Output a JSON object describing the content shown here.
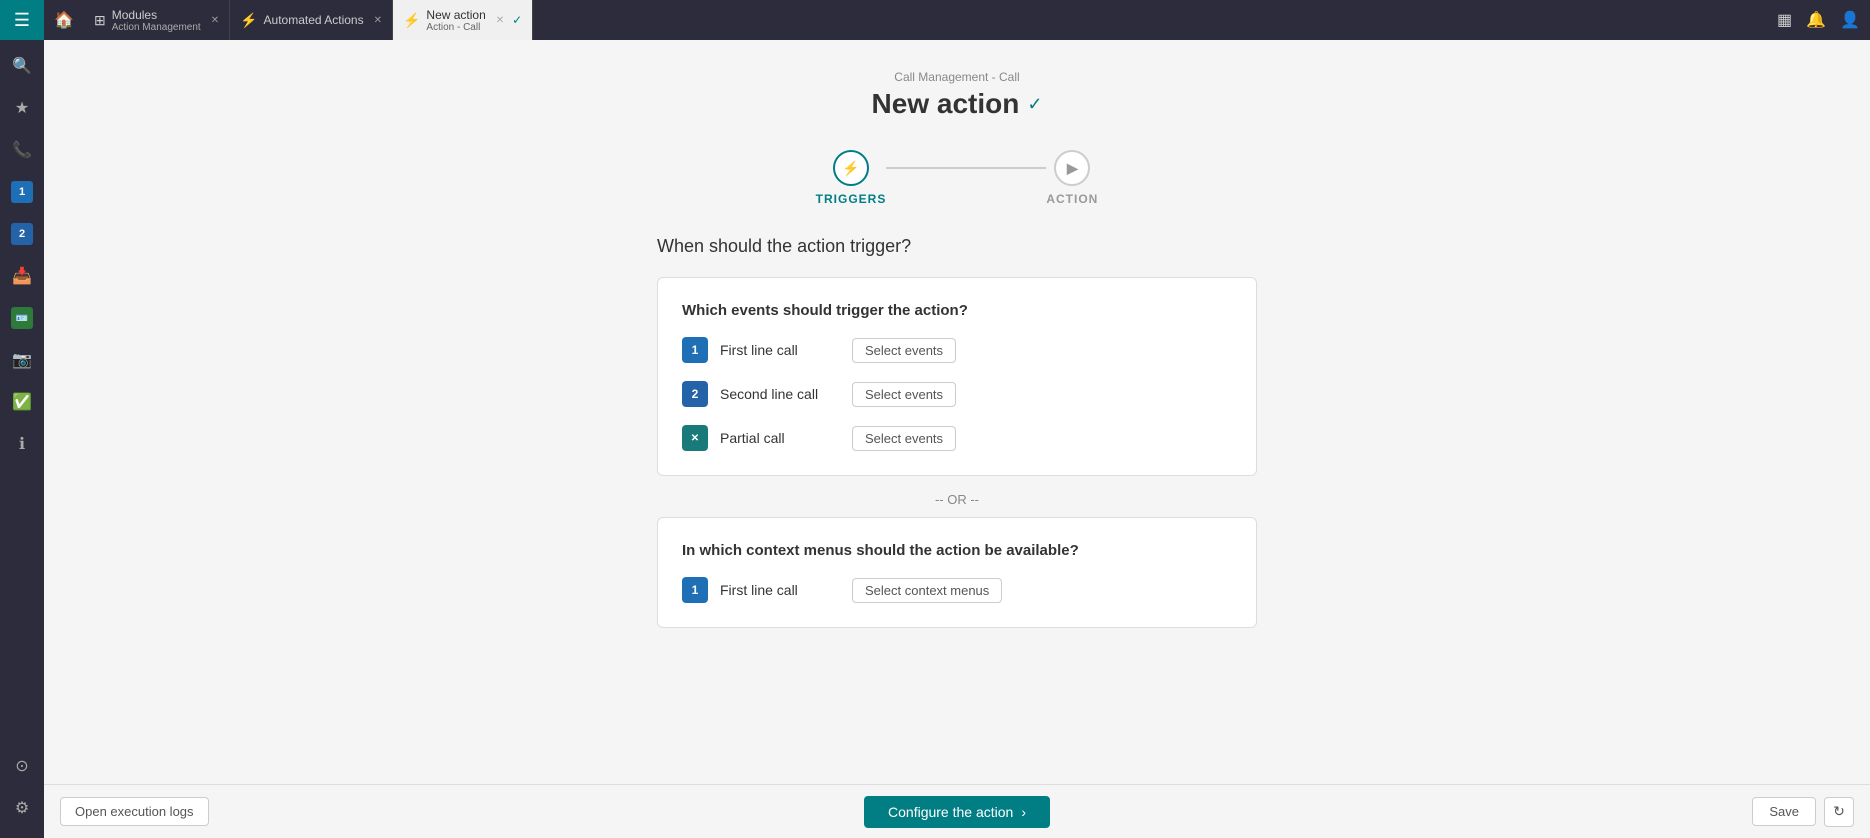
{
  "topbar": {
    "tabs": [
      {
        "id": "modules",
        "icon": "⊞",
        "label": "Modules",
        "sublabel": "Action Management",
        "active": false,
        "closable": true
      },
      {
        "id": "automated-actions",
        "icon": "⚡",
        "label": "Automated Actions",
        "sublabel": "",
        "active": false,
        "closable": true
      },
      {
        "id": "new-action",
        "icon": "⚡",
        "label": "New action",
        "sublabel": "Action - Call",
        "active": true,
        "closable": true
      }
    ],
    "right_icons": [
      "▦",
      "🔔",
      "👤"
    ]
  },
  "sidebar": {
    "items": [
      {
        "id": "search",
        "icon": "🔍"
      },
      {
        "id": "star",
        "icon": "★"
      },
      {
        "id": "phone",
        "icon": "📞"
      },
      {
        "id": "badge1",
        "icon": "①"
      },
      {
        "id": "badge2",
        "icon": "②"
      },
      {
        "id": "inbox",
        "icon": "📥"
      },
      {
        "id": "badge-green",
        "icon": "🪪"
      },
      {
        "id": "camera",
        "icon": "📷"
      },
      {
        "id": "approval",
        "icon": "✅"
      },
      {
        "id": "info",
        "icon": "ℹ"
      }
    ],
    "bottom": [
      {
        "id": "expand",
        "icon": "⊙"
      },
      {
        "id": "settings",
        "icon": "⚙"
      }
    ]
  },
  "page": {
    "breadcrumb": "Call Management - Call",
    "title": "New action",
    "verified_symbol": "✓",
    "stepper": {
      "step1_label": "TRIGGERS",
      "step2_label": "ACTION"
    },
    "section_title": "When should the action trigger?",
    "events_card": {
      "title": "Which events should trigger the action?",
      "rows": [
        {
          "id": "first-line",
          "icon_text": "1",
          "icon_class": "blue1",
          "label": "First line call",
          "btn_text": "Select events"
        },
        {
          "id": "second-line",
          "icon_text": "2",
          "icon_class": "blue2",
          "label": "Second line call",
          "btn_text": "Select events"
        },
        {
          "id": "partial",
          "icon_text": "✕",
          "icon_class": "teal",
          "label": "Partial call",
          "btn_text": "Select events"
        }
      ]
    },
    "or_divider": "-- OR --",
    "context_card": {
      "title": "In which context menus should the action be available?",
      "rows": [
        {
          "id": "ctx-first-line",
          "icon_text": "1",
          "icon_class": "blue1",
          "label": "First line call",
          "btn_text": "Select context menus"
        }
      ]
    }
  },
  "bottom_bar": {
    "open_logs_label": "Open execution logs",
    "configure_label": "Configure the action",
    "configure_arrow": "›",
    "save_label": "Save",
    "refresh_label": "↻"
  }
}
